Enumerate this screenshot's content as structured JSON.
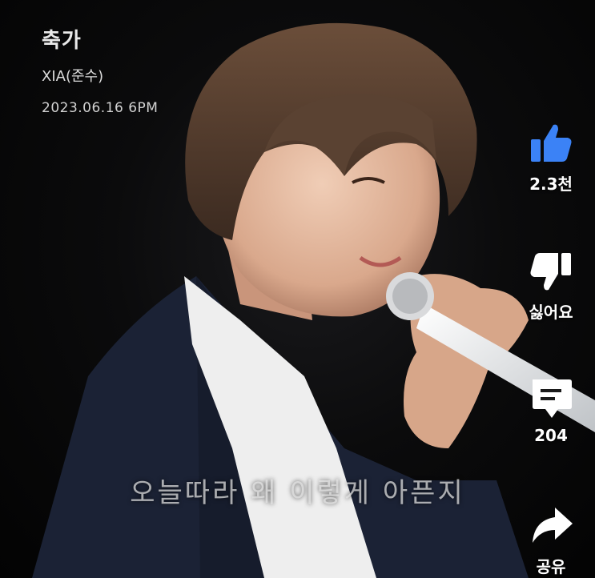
{
  "video": {
    "title": "축가",
    "artist": "XIA(준수)",
    "date": "2023.06.16 6PM",
    "subtitle": "오늘따라 왜 이렇게 아픈지"
  },
  "actions": {
    "like": {
      "icon": "thumbs-up-icon",
      "label": "2.3천",
      "color": "#3b82f6",
      "active": true
    },
    "dislike": {
      "icon": "thumbs-down-icon",
      "label": "싫어요"
    },
    "comments": {
      "icon": "comment-icon",
      "label": "204"
    },
    "share": {
      "icon": "share-icon",
      "label": "공유"
    }
  }
}
